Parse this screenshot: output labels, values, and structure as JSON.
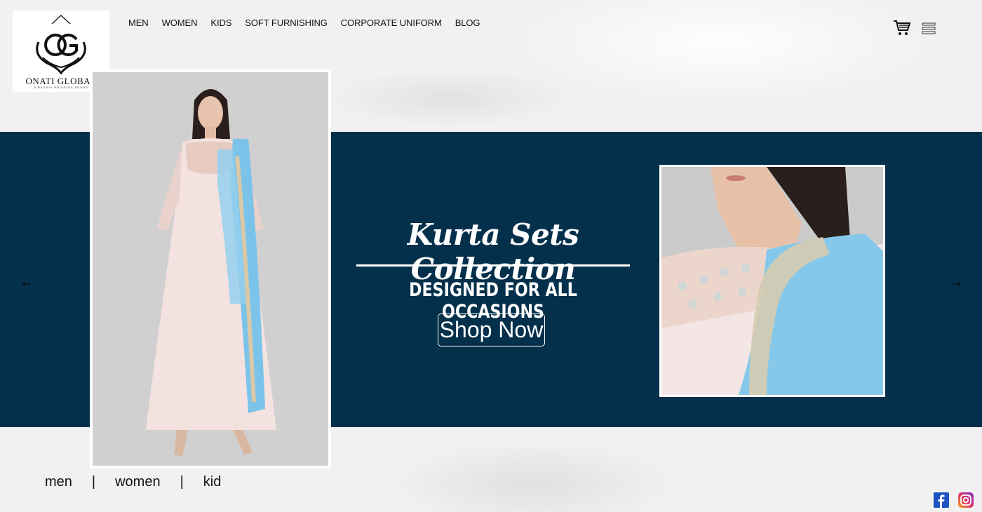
{
  "brand": {
    "name": "ONATI GLOBAL",
    "tagline": "A RAGHIV PRIVATES BRAND",
    "monogram": "OG"
  },
  "nav": {
    "items": [
      {
        "label": "MEN"
      },
      {
        "label": "WOMEN"
      },
      {
        "label": "KIDS"
      },
      {
        "label": "SOFT FURNISHING"
      },
      {
        "label": "CORPORATE UNIFORM"
      },
      {
        "label": "BLOG"
      }
    ]
  },
  "header_icons": {
    "cart": "cart-icon",
    "menu": "menu-icon"
  },
  "hero": {
    "title": "Kurta Sets Collection",
    "subtitle": "DESIGNED FOR ALL OCCASIONS",
    "cta_label": "Shop Now",
    "prev_arrow": "←",
    "next_arrow": "→",
    "background_color": "#04304b"
  },
  "categories": {
    "items": [
      {
        "label": "men"
      },
      {
        "label": "women"
      },
      {
        "label": "kid"
      }
    ],
    "separator": "|"
  },
  "social": {
    "facebook": "facebook-icon",
    "instagram": "instagram-icon"
  }
}
